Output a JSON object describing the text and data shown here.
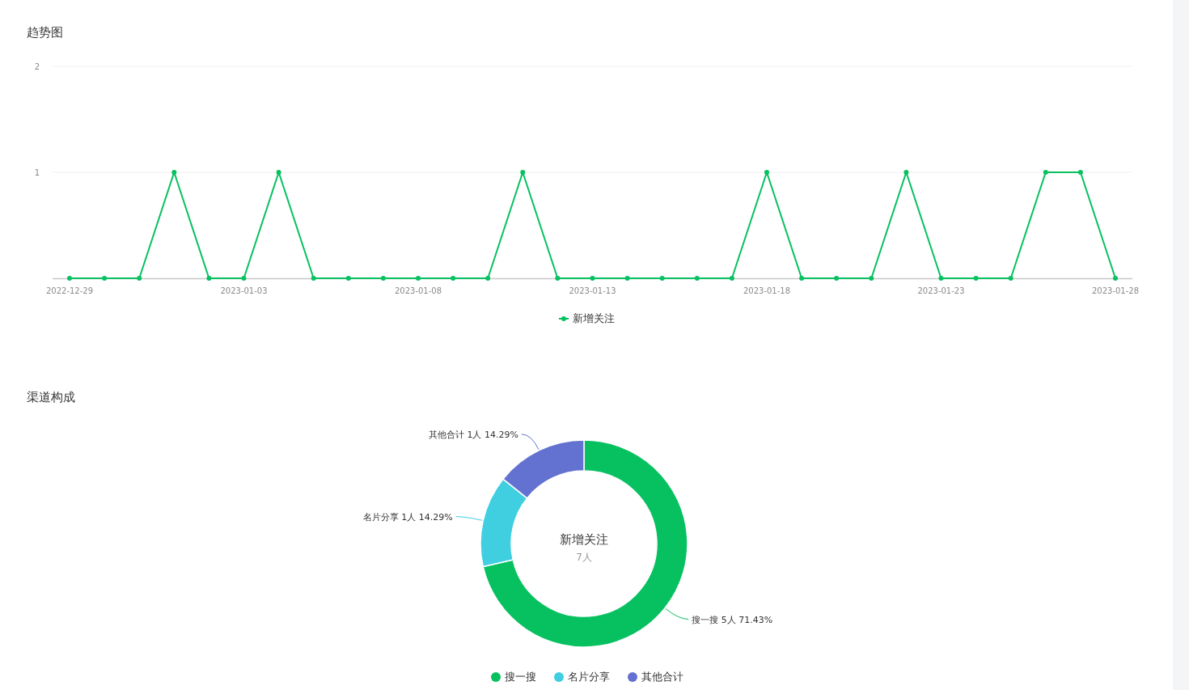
{
  "trend": {
    "title": "趋势图",
    "chart_data": {
      "type": "line",
      "categories": [
        "2022-12-29",
        null,
        null,
        null,
        null,
        "2023-01-03",
        null,
        null,
        null,
        null,
        "2023-01-08",
        null,
        null,
        null,
        null,
        "2023-01-13",
        null,
        null,
        null,
        null,
        "2023-01-18",
        null,
        null,
        null,
        null,
        "2023-01-23",
        null,
        null,
        null,
        null,
        "2023-01-28"
      ],
      "series": [
        {
          "name": "新增关注",
          "color": "#07c160",
          "marker": true,
          "values": [
            0,
            0,
            0,
            1,
            0,
            0,
            1,
            0,
            0,
            0,
            0,
            0,
            0,
            1,
            0,
            0,
            0,
            0,
            0,
            0,
            1,
            0,
            0,
            0,
            1,
            0,
            0,
            0,
            1,
            1,
            0
          ]
        }
      ],
      "ylim": [
        0,
        2
      ],
      "yticks": [
        1,
        2
      ]
    }
  },
  "channels": {
    "title": "渠道构成",
    "center_title": "新增关注",
    "center_value": "7人",
    "legend": [
      {
        "color": "#07c160"
      },
      {
        "color": "#40cfe0"
      },
      {
        "color": "#6372d0"
      }
    ],
    "chart_data": {
      "type": "donut",
      "categories": [
        "搜一搜",
        "名片分享",
        "其他合计"
      ],
      "values": [
        5,
        1,
        1
      ],
      "value_labels": [
        "搜一搜 5人 71.43%",
        "名片分享 1人 14.29%",
        "其他合计 1人 14.29%"
      ]
    }
  }
}
